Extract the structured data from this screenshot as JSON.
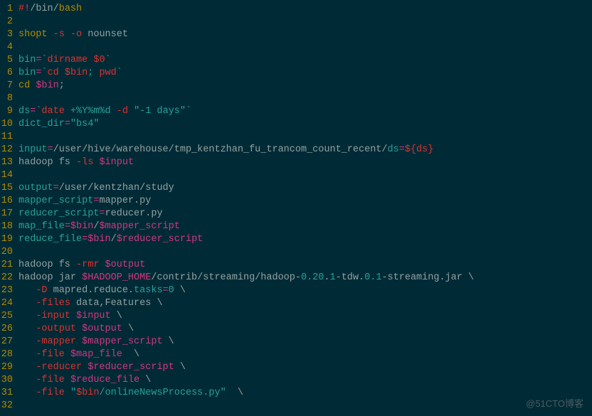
{
  "watermark": "@51CTO博客",
  "lines": [
    {
      "n": 1,
      "tokens": [
        {
          "t": "#",
          "c": "red"
        },
        {
          "t": "!",
          "c": "magenta"
        },
        {
          "t": "/bin/",
          "c": "base"
        },
        {
          "t": "bash",
          "c": "yellow"
        }
      ]
    },
    {
      "n": 2,
      "tokens": []
    },
    {
      "n": 3,
      "tokens": [
        {
          "t": "shopt",
          "c": "yellow"
        },
        {
          "t": " ",
          "c": "base"
        },
        {
          "t": "-s",
          "c": "red"
        },
        {
          "t": " ",
          "c": "base"
        },
        {
          "t": "-o",
          "c": "red"
        },
        {
          "t": " nounset",
          "c": "base"
        }
      ]
    },
    {
      "n": 4,
      "tokens": []
    },
    {
      "n": 5,
      "tokens": [
        {
          "t": "bin",
          "c": "cyan"
        },
        {
          "t": "=",
          "c": "magenta"
        },
        {
          "t": "`",
          "c": "cyan"
        },
        {
          "t": "dirname",
          "c": "red"
        },
        {
          "t": " ",
          "c": "cyan"
        },
        {
          "t": "$0",
          "c": "red"
        },
        {
          "t": "`",
          "c": "cyan"
        }
      ]
    },
    {
      "n": 6,
      "tokens": [
        {
          "t": "bin",
          "c": "cyan"
        },
        {
          "t": "=",
          "c": "magenta"
        },
        {
          "t": "`",
          "c": "cyan"
        },
        {
          "t": "cd",
          "c": "red"
        },
        {
          "t": " ",
          "c": "cyan"
        },
        {
          "t": "$bin",
          "c": "red"
        },
        {
          "t": "; ",
          "c": "cyan"
        },
        {
          "t": "pwd",
          "c": "red"
        },
        {
          "t": "`",
          "c": "cyan"
        }
      ]
    },
    {
      "n": 7,
      "tokens": [
        {
          "t": "cd",
          "c": "yellow"
        },
        {
          "t": " ",
          "c": "base"
        },
        {
          "t": "$bin",
          "c": "magenta"
        },
        {
          "t": ";",
          "c": "base"
        }
      ]
    },
    {
      "n": 8,
      "tokens": []
    },
    {
      "n": 9,
      "tokens": [
        {
          "t": "ds",
          "c": "cyan"
        },
        {
          "t": "=",
          "c": "magenta"
        },
        {
          "t": "`",
          "c": "cyan"
        },
        {
          "t": "date",
          "c": "red"
        },
        {
          "t": " +%Y%m%d ",
          "c": "cyan"
        },
        {
          "t": "-d",
          "c": "red"
        },
        {
          "t": " ",
          "c": "cyan"
        },
        {
          "t": "\"-1 days\"",
          "c": "cyan"
        },
        {
          "t": "`",
          "c": "cyan"
        }
      ]
    },
    {
      "n": 10,
      "tokens": [
        {
          "t": "dict_dir",
          "c": "cyan"
        },
        {
          "t": "=",
          "c": "magenta"
        },
        {
          "t": "\"bs4\"",
          "c": "cyan"
        }
      ]
    },
    {
      "n": 11,
      "tokens": []
    },
    {
      "n": 12,
      "tokens": [
        {
          "t": "input",
          "c": "cyan"
        },
        {
          "t": "=",
          "c": "magenta"
        },
        {
          "t": "/user/hive/warehouse/tmp_kentzhan_fu_trancom_count_recent/",
          "c": "base"
        },
        {
          "t": "ds",
          "c": "cyan"
        },
        {
          "t": "=",
          "c": "magenta"
        },
        {
          "t": "${ds}",
          "c": "red"
        }
      ]
    },
    {
      "n": 13,
      "tokens": [
        {
          "t": "hadoop fs ",
          "c": "base"
        },
        {
          "t": "-ls",
          "c": "red"
        },
        {
          "t": " ",
          "c": "base"
        },
        {
          "t": "$input",
          "c": "magenta"
        }
      ]
    },
    {
      "n": 14,
      "tokens": []
    },
    {
      "n": 15,
      "tokens": [
        {
          "t": "output",
          "c": "cyan"
        },
        {
          "t": "=",
          "c": "magenta"
        },
        {
          "t": "/user/kentzhan/study",
          "c": "base"
        }
      ]
    },
    {
      "n": 16,
      "tokens": [
        {
          "t": "mapper_script",
          "c": "cyan"
        },
        {
          "t": "=",
          "c": "magenta"
        },
        {
          "t": "mapper.py",
          "c": "base"
        }
      ]
    },
    {
      "n": 17,
      "tokens": [
        {
          "t": "reducer_script",
          "c": "cyan"
        },
        {
          "t": "=",
          "c": "magenta"
        },
        {
          "t": "reducer.py",
          "c": "base"
        }
      ]
    },
    {
      "n": 18,
      "tokens": [
        {
          "t": "map_file",
          "c": "cyan"
        },
        {
          "t": "=",
          "c": "magenta"
        },
        {
          "t": "$bin",
          "c": "magenta"
        },
        {
          "t": "/",
          "c": "base"
        },
        {
          "t": "$mapper_script",
          "c": "magenta"
        }
      ]
    },
    {
      "n": 19,
      "tokens": [
        {
          "t": "reduce_file",
          "c": "cyan"
        },
        {
          "t": "=",
          "c": "magenta"
        },
        {
          "t": "$bin",
          "c": "magenta"
        },
        {
          "t": "/",
          "c": "base"
        },
        {
          "t": "$reducer_script",
          "c": "magenta"
        }
      ]
    },
    {
      "n": 20,
      "tokens": []
    },
    {
      "n": 21,
      "tokens": [
        {
          "t": "hadoop fs ",
          "c": "base"
        },
        {
          "t": "-rmr",
          "c": "red"
        },
        {
          "t": " ",
          "c": "base"
        },
        {
          "t": "$output",
          "c": "magenta"
        }
      ]
    },
    {
      "n": 22,
      "tokens": [
        {
          "t": "hadoop jar ",
          "c": "base"
        },
        {
          "t": "$HADOOP_HOME",
          "c": "magenta"
        },
        {
          "t": "/contrib/streaming/hadoop-",
          "c": "base"
        },
        {
          "t": "0.20",
          "c": "cyan"
        },
        {
          "t": ".",
          "c": "base"
        },
        {
          "t": "1",
          "c": "cyan"
        },
        {
          "t": "-tdw.",
          "c": "base"
        },
        {
          "t": "0.1",
          "c": "cyan"
        },
        {
          "t": "-streaming.jar \\",
          "c": "base"
        }
      ]
    },
    {
      "n": 23,
      "tokens": [
        {
          "t": "   ",
          "c": "base"
        },
        {
          "t": "-D",
          "c": "red"
        },
        {
          "t": " mapred.reduce.",
          "c": "base"
        },
        {
          "t": "tasks",
          "c": "cyan"
        },
        {
          "t": "=",
          "c": "magenta"
        },
        {
          "t": "0",
          "c": "cyan"
        },
        {
          "t": " \\",
          "c": "base"
        }
      ]
    },
    {
      "n": 24,
      "tokens": [
        {
          "t": "   ",
          "c": "base"
        },
        {
          "t": "-files",
          "c": "red"
        },
        {
          "t": " data,Features \\",
          "c": "base"
        }
      ]
    },
    {
      "n": 25,
      "tokens": [
        {
          "t": "   ",
          "c": "base"
        },
        {
          "t": "-input",
          "c": "red"
        },
        {
          "t": " ",
          "c": "base"
        },
        {
          "t": "$input",
          "c": "magenta"
        },
        {
          "t": " \\",
          "c": "base"
        }
      ]
    },
    {
      "n": 26,
      "tokens": [
        {
          "t": "   ",
          "c": "base"
        },
        {
          "t": "-output",
          "c": "red"
        },
        {
          "t": " ",
          "c": "base"
        },
        {
          "t": "$output",
          "c": "magenta"
        },
        {
          "t": " \\",
          "c": "base"
        }
      ]
    },
    {
      "n": 27,
      "tokens": [
        {
          "t": "   ",
          "c": "base"
        },
        {
          "t": "-mapper",
          "c": "red"
        },
        {
          "t": " ",
          "c": "base"
        },
        {
          "t": "$mapper_script",
          "c": "magenta"
        },
        {
          "t": " \\",
          "c": "base"
        }
      ]
    },
    {
      "n": 28,
      "tokens": [
        {
          "t": "   ",
          "c": "base"
        },
        {
          "t": "-file",
          "c": "red"
        },
        {
          "t": " ",
          "c": "base"
        },
        {
          "t": "$map_file",
          "c": "magenta"
        },
        {
          "t": "  \\",
          "c": "base"
        }
      ]
    },
    {
      "n": 29,
      "tokens": [
        {
          "t": "   ",
          "c": "base"
        },
        {
          "t": "-reducer",
          "c": "red"
        },
        {
          "t": " ",
          "c": "base"
        },
        {
          "t": "$reducer_script",
          "c": "magenta"
        },
        {
          "t": " \\",
          "c": "base"
        }
      ]
    },
    {
      "n": 30,
      "tokens": [
        {
          "t": "   ",
          "c": "base"
        },
        {
          "t": "-file",
          "c": "red"
        },
        {
          "t": " ",
          "c": "base"
        },
        {
          "t": "$reduce_file",
          "c": "magenta"
        },
        {
          "t": " \\",
          "c": "base"
        }
      ]
    },
    {
      "n": 31,
      "tokens": [
        {
          "t": "   ",
          "c": "base"
        },
        {
          "t": "-file",
          "c": "red"
        },
        {
          "t": " ",
          "c": "base"
        },
        {
          "t": "\"",
          "c": "cyan"
        },
        {
          "t": "$bin",
          "c": "red"
        },
        {
          "t": "/onlineNewsProcess.py\"",
          "c": "cyan"
        },
        {
          "t": "  \\",
          "c": "base"
        }
      ]
    },
    {
      "n": 32,
      "tokens": []
    }
  ]
}
